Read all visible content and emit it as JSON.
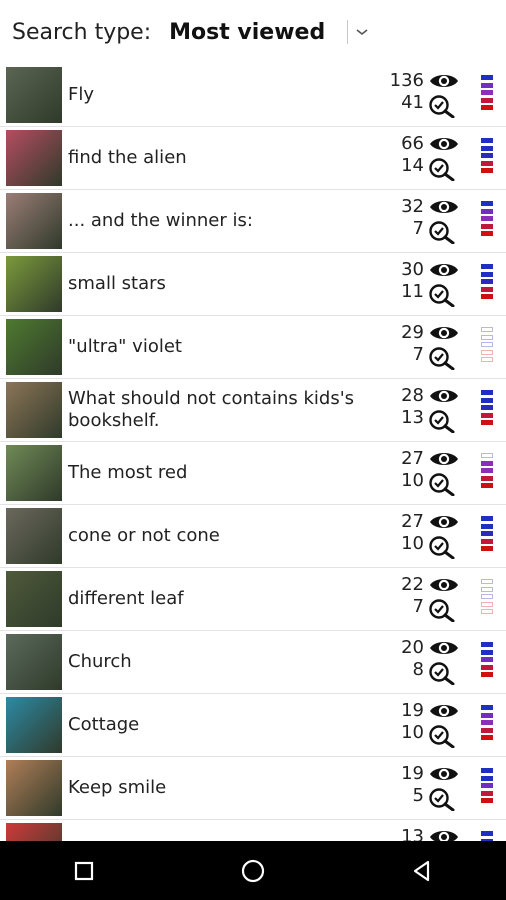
{
  "header": {
    "label": "Search type:",
    "value": "Most viewed"
  },
  "rows": [
    {
      "title": "Fly",
      "views": "136",
      "count": "41",
      "thumb": "#5b6552",
      "bars": [
        "#1f2fbf",
        "#6f2fbf",
        "#8a2fb6",
        "#c0183a",
        "#d01010"
      ]
    },
    {
      "title": "find the alien",
      "views": "66",
      "count": "14",
      "thumb": "#b54d60",
      "bars": [
        "#1f2fbf",
        "#1f2fbf",
        "#2a2abb",
        "#c0183a",
        "#d01010"
      ]
    },
    {
      "title": "... and the winner is:",
      "views": "32",
      "count": "7",
      "thumb": "#9b7d76",
      "bars": [
        "#1f2fbf",
        "#6f2fbf",
        "#8a2fb6",
        "#c0183a",
        "#d01010"
      ]
    },
    {
      "title": "small stars",
      "views": "30",
      "count": "11",
      "thumb": "#7b9a3c",
      "bars": [
        "#1f2fbf",
        "#1f2fbf",
        "#2a2abb",
        "#c0183a",
        "#d01010"
      ]
    },
    {
      "title": "\"ultra\" violet",
      "views": "29",
      "count": "7",
      "thumb": "#4e7a30",
      "bars": [
        "empty-blue",
        "empty-blue",
        "empty-blue",
        "empty-red",
        "empty-red"
      ]
    },
    {
      "title": "What should not contains kids's bookshelf.",
      "views": "28",
      "count": "13",
      "thumb": "#8c7557",
      "bars": [
        "#1f2fbf",
        "#1f2fbf",
        "#2a2abb",
        "#c0183a",
        "#d01010"
      ]
    },
    {
      "title": "The most red",
      "views": "27",
      "count": "10",
      "thumb": "#6f8a56",
      "bars": [
        "empty-blue",
        "#8a2fb6",
        "#8a2fb6",
        "#c0183a",
        "#d01010"
      ]
    },
    {
      "title": "cone or not cone",
      "views": "27",
      "count": "10",
      "thumb": "#6b685c",
      "bars": [
        "#1f2fbf",
        "#1f2fbf",
        "#2a2abb",
        "#c0183a",
        "#d01010"
      ]
    },
    {
      "title": "different leaf",
      "views": "22",
      "count": "7",
      "thumb": "#4f5a3b",
      "bars": [
        "empty-blue",
        "empty-blue",
        "empty-blue",
        "empty-red",
        "empty-red"
      ]
    },
    {
      "title": "Church",
      "views": "20",
      "count": "8",
      "thumb": "#5b6a5c",
      "bars": [
        "#1f2fbf",
        "#1f2fbf",
        "#6f2fbf",
        "#c0183a",
        "#d01010"
      ]
    },
    {
      "title": "Cottage",
      "views": "19",
      "count": "10",
      "thumb": "#2e8aa5",
      "bars": [
        "#1f2fbf",
        "#6f2fbf",
        "#8a2fb6",
        "#c0183a",
        "#d01010"
      ]
    },
    {
      "title": "Keep smile",
      "views": "19",
      "count": "5",
      "thumb": "#b07e58",
      "bars": [
        "#1f2fbf",
        "#1f2fbf",
        "#6f2fbf",
        "#c0183a",
        "#d01010"
      ]
    },
    {
      "title": "",
      "views": "13",
      "count": "",
      "thumb": "#cf3a3a",
      "bars": [
        "#1f2fbf",
        "#1f2fbf",
        "#6f2fbf",
        "#c0183a",
        "#d01010"
      ]
    }
  ],
  "icons": {
    "views": "eye-icon",
    "count": "magnifier-check-icon",
    "dropdown": "chevron-down-icon",
    "nav": [
      "recents-square-icon",
      "home-circle-icon",
      "back-triangle-icon"
    ]
  }
}
